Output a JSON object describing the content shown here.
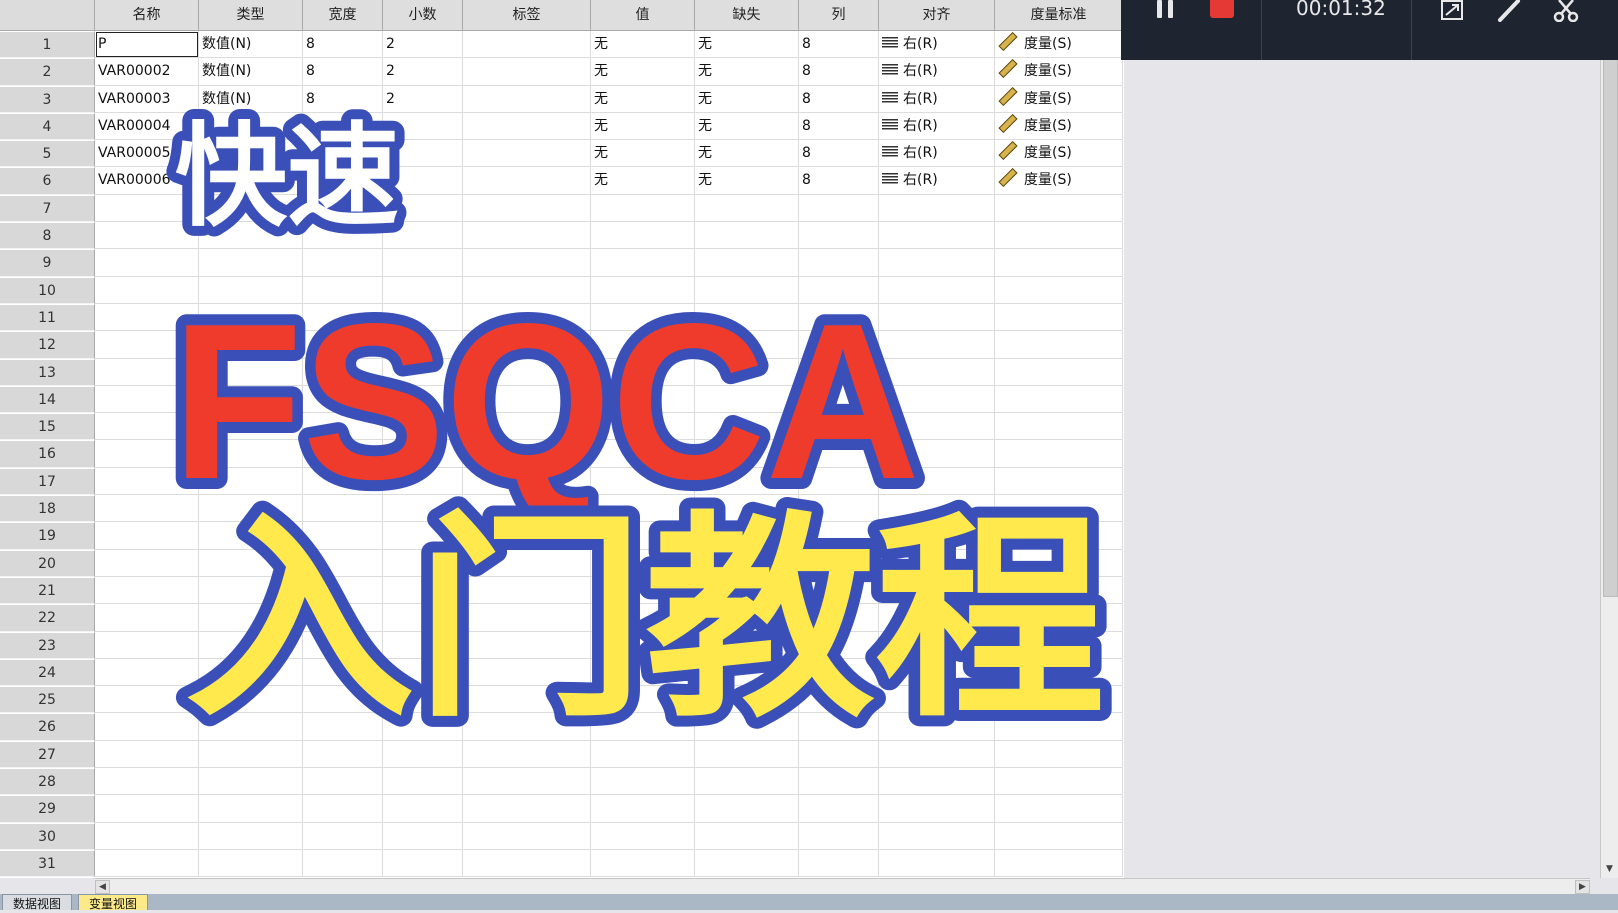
{
  "variable_view": {
    "columns": [
      "名称",
      "类型",
      "宽度",
      "小数",
      "标签",
      "值",
      "缺失",
      "列",
      "对齐",
      "度量标准"
    ],
    "row_numbers": [
      "1",
      "2",
      "3",
      "4",
      "5",
      "6",
      "7",
      "8",
      "9",
      "10",
      "11",
      "12",
      "13",
      "14",
      "15",
      "16",
      "17",
      "18",
      "19",
      "20",
      "21",
      "22",
      "23",
      "24",
      "25",
      "26",
      "27",
      "28",
      "29",
      "30",
      "31"
    ],
    "rows": [
      {
        "name": "P",
        "type": "数值(N)",
        "width": "8",
        "decimals": "2",
        "label": "",
        "values": "无",
        "missing": "无",
        "columns": "8",
        "align": "右(R)",
        "measure": "度量(S)"
      },
      {
        "name": "VAR00002",
        "type": "数值(N)",
        "width": "8",
        "decimals": "2",
        "label": "",
        "values": "无",
        "missing": "无",
        "columns": "8",
        "align": "右(R)",
        "measure": "度量(S)"
      },
      {
        "name": "VAR00003",
        "type": "数值(N)",
        "width": "8",
        "decimals": "2",
        "label": "",
        "values": "无",
        "missing": "无",
        "columns": "8",
        "align": "右(R)",
        "measure": "度量(S)"
      },
      {
        "name": "VAR00004",
        "type": "",
        "width": "",
        "decimals": "",
        "label": "",
        "values": "无",
        "missing": "无",
        "columns": "8",
        "align": "右(R)",
        "measure": "度量(S)"
      },
      {
        "name": "VAR00005",
        "type": "",
        "width": "",
        "decimals": "",
        "label": "",
        "values": "无",
        "missing": "无",
        "columns": "8",
        "align": "右(R)",
        "measure": "度量(S)"
      },
      {
        "name": "VAR00006",
        "type": "",
        "width": "",
        "decimals": "",
        "label": "",
        "values": "无",
        "missing": "无",
        "columns": "8",
        "align": "右(R)",
        "measure": "度量(S)"
      }
    ]
  },
  "tabs": {
    "data_view": "数据视图",
    "variable_view": "变量视图"
  },
  "recorder": {
    "timer": "00:01:32",
    "pause_icon": "pause-icon",
    "stop_icon": "stop-icon",
    "expand_icon": "expand-icon",
    "pen_icon": "pen-icon",
    "scissors_icon": "scissors-icon",
    "stop_color": "#e53935"
  },
  "overlay": {
    "line1": "快速",
    "line2": "FSQCA",
    "line3": "入门教程",
    "colors": {
      "outline": "#3b4fb8",
      "red_fill": "#ef3b2c",
      "yellow_fill": "#ffe94d",
      "white_fill": "#ffffff"
    }
  }
}
